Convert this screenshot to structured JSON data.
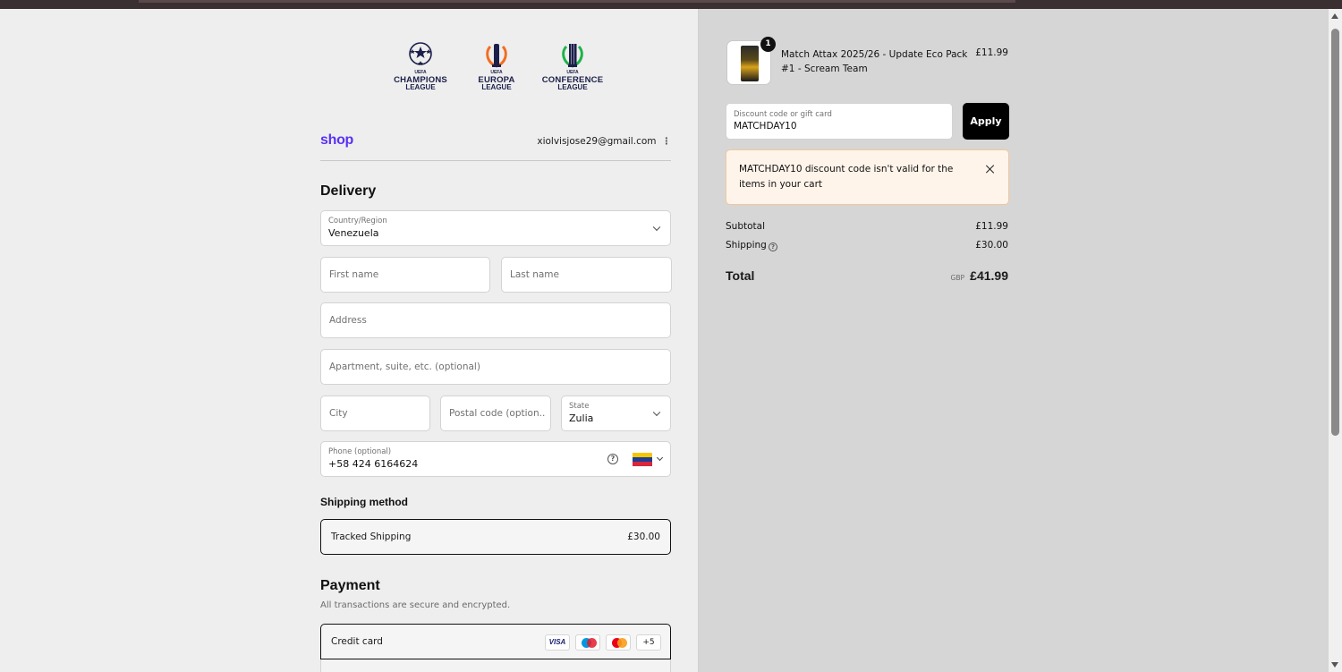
{
  "leagues": [
    {
      "name_line1": "CHAMPIONS",
      "name_line2": "LEAGUE"
    },
    {
      "name_line1": "EUROPA",
      "name_line2": "LEAGUE"
    },
    {
      "name_line1": "CONFERENCE",
      "name_line2": "LEAGUE"
    }
  ],
  "uefa_label": "UEFA",
  "shop": {
    "logo": "shop",
    "email": "xiolvisjose29@gmail.com"
  },
  "delivery": {
    "title": "Delivery",
    "country": {
      "label": "Country/Region",
      "value": "Venezuela"
    },
    "first_name": {
      "placeholder": "First name"
    },
    "last_name": {
      "placeholder": "Last name"
    },
    "address": {
      "placeholder": "Address"
    },
    "apartment": {
      "placeholder": "Apartment, suite, etc. (optional)"
    },
    "city": {
      "placeholder": "City"
    },
    "postal": {
      "placeholder": "Postal code (option..."
    },
    "state": {
      "label": "State",
      "value": "Zulia"
    },
    "phone": {
      "label": "Phone (optional)",
      "value": "+58 424 6164624"
    }
  },
  "shipping_method": {
    "title": "Shipping method",
    "option": "Tracked Shipping",
    "price": "£30.00"
  },
  "payment": {
    "title": "Payment",
    "subtitle": "All transactions are secure and encrypted.",
    "method": "Credit card",
    "cards": {
      "visa": "VISA",
      "more": "+5"
    }
  },
  "cart": {
    "quantity": "1",
    "item_name": "Match Attax 2025/26 - Update Eco Pack #1 - Scream Team",
    "item_price": "£11.99"
  },
  "discount": {
    "label": "Discount code or gift card",
    "value": "MATCHDAY10",
    "apply_label": "Apply",
    "error": "MATCHDAY10 discount code isn't valid for the items in your cart"
  },
  "summary": {
    "subtotal_label": "Subtotal",
    "subtotal": "£11.99",
    "shipping_label": "Shipping",
    "shipping": "£30.00",
    "total_label": "Total",
    "currency": "GBP",
    "total": "£41.99"
  },
  "colors": {
    "shop_brand": "#5a31f4",
    "error_bg": "#fff4ea",
    "apply_bg": "#000000"
  }
}
